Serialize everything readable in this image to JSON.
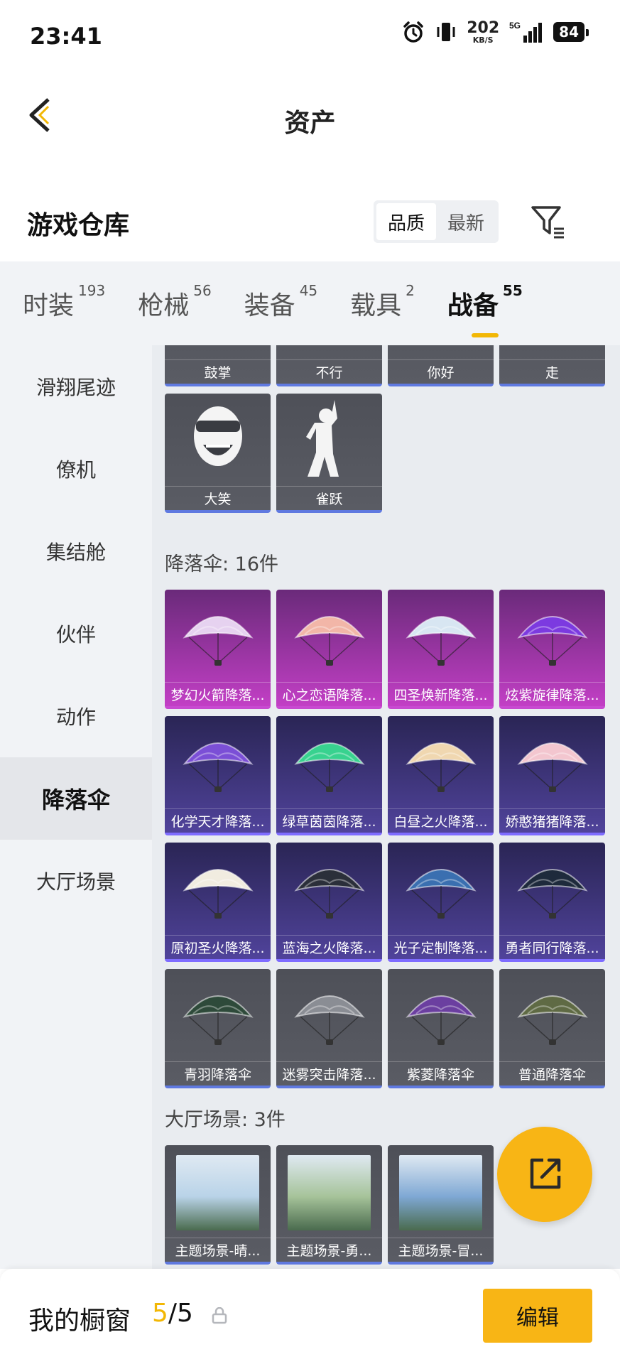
{
  "status_bar": {
    "time": "23:41",
    "net_speed": "202",
    "net_unit": "KB/S",
    "signal": "5G",
    "battery": "84"
  },
  "header": {
    "title": "资产"
  },
  "warehouse": {
    "title": "游戏仓库",
    "sort_options": [
      "品质",
      "最新"
    ],
    "sort_selected": "品质"
  },
  "tabs": [
    {
      "label": "时装",
      "count": "193"
    },
    {
      "label": "枪械",
      "count": "56"
    },
    {
      "label": "装备",
      "count": "45"
    },
    {
      "label": "载具",
      "count": "2"
    },
    {
      "label": "战备",
      "count": "55"
    }
  ],
  "active_tab": "战备",
  "sidebar": {
    "items": [
      "滑翔尾迹",
      "僚机",
      "集结舱",
      "伙伴",
      "动作",
      "降落伞",
      "大厅场景"
    ],
    "active": "降落伞"
  },
  "emotes_partial": [
    "鼓掌",
    "不行",
    "你好",
    "走"
  ],
  "emotes": [
    "大笑",
    "雀跃"
  ],
  "parachute_section": {
    "label": "降落伞: 16件",
    "items": [
      {
        "name": "梦幻火箭降落...",
        "tier": "pink",
        "color": "#e6d2f0"
      },
      {
        "name": "心之恋语降落...",
        "tier": "pink",
        "color": "#f2b6a8"
      },
      {
        "name": "四圣焕新降落...",
        "tier": "pink",
        "color": "#d8e6f2"
      },
      {
        "name": "炫紫旋律降落...",
        "tier": "pink",
        "color": "#7c3ae0"
      },
      {
        "name": "化学天才降落...",
        "tier": "purple",
        "color": "#7b4fd6"
      },
      {
        "name": "绿草茵茵降落...",
        "tier": "purple",
        "color": "#38d28f"
      },
      {
        "name": "白昼之火降落...",
        "tier": "purple",
        "color": "#f0d7b0"
      },
      {
        "name": "娇憨猪猪降落...",
        "tier": "purple",
        "color": "#f3c6cf"
      },
      {
        "name": "原初圣火降落...",
        "tier": "purple",
        "color": "#f1ece0"
      },
      {
        "name": "蓝海之火降落...",
        "tier": "purple",
        "color": "#2b2f3a"
      },
      {
        "name": "光子定制降落...",
        "tier": "purple",
        "color": "#3a6fb0"
      },
      {
        "name": "勇者同行降落...",
        "tier": "purple",
        "color": "#1e2a3c"
      },
      {
        "name": "青羽降落伞",
        "tier": "grey",
        "color": "#2e4a3a"
      },
      {
        "name": "迷雾突击降落...",
        "tier": "grey",
        "color": "#8a8d94"
      },
      {
        "name": "紫菱降落伞",
        "tier": "grey",
        "color": "#6b3fa0"
      },
      {
        "name": "普通降落伞",
        "tier": "grey",
        "color": "#5f6a44"
      }
    ]
  },
  "hall_scene_section": {
    "label": "大厅场景: 3件",
    "items": [
      {
        "name": "主题场景-晴...",
        "color": "#b9d3e8"
      },
      {
        "name": "主题场景-勇...",
        "color": "#a6c39a"
      },
      {
        "name": "主题场景-冒...",
        "color": "#7fa8d4"
      }
    ]
  },
  "bottom_bar": {
    "showcase_label": "我的橱窗",
    "showcase_current": "5",
    "showcase_total": "/5",
    "edit_label": "编辑"
  },
  "colors": {
    "accent": "#f8b515",
    "tab_underline": "#f2b705"
  }
}
